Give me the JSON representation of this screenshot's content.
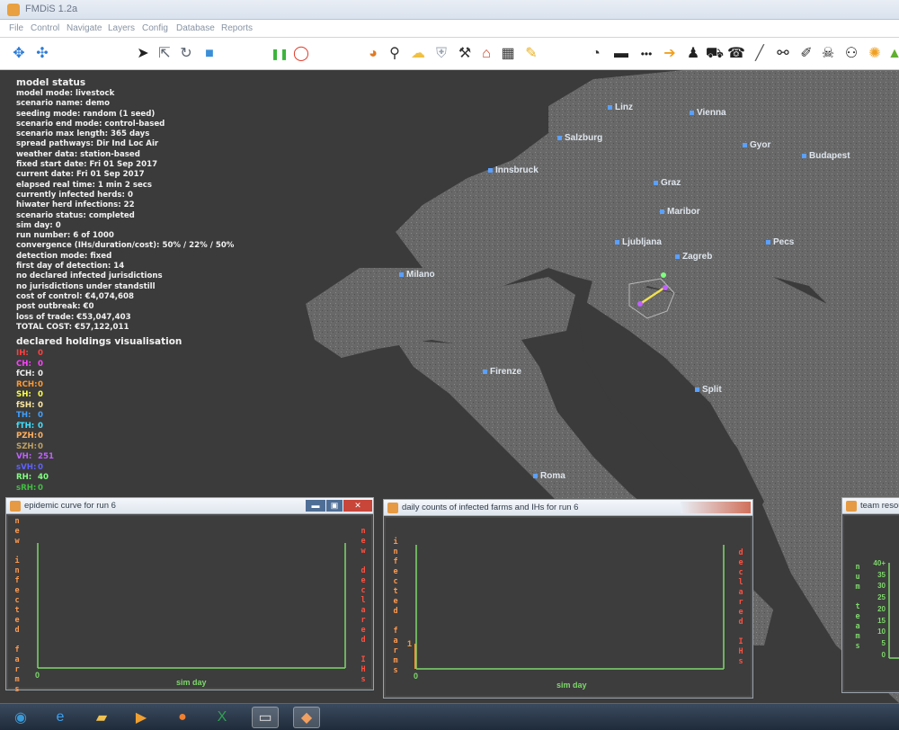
{
  "window": {
    "title": "FMDiS 1.2a"
  },
  "menu": [
    "File",
    "Control",
    "Navigate",
    "Layers",
    "Config",
    "Database",
    "Reports"
  ],
  "toolbar_icons": [
    {
      "name": "zoom-extent-icon",
      "glyph": "✥",
      "color": "#2b7bd6"
    },
    {
      "name": "pan-icon",
      "glyph": "✣",
      "color": "#2b7bd6"
    },
    {
      "name": "select-arrow-icon",
      "glyph": "➤",
      "color": "#222222"
    },
    {
      "name": "pointer-icon",
      "glyph": "⇱",
      "color": "#5b6470"
    },
    {
      "name": "refresh-icon",
      "glyph": "↻",
      "color": "#5b6470"
    },
    {
      "name": "cube-icon",
      "glyph": "■",
      "color": "#3a8fd8"
    },
    {
      "name": "pause-icon",
      "glyph": "❚❚",
      "color": "#3cb43c"
    },
    {
      "name": "stop-icon",
      "glyph": "◯",
      "color": "#e03c2c"
    },
    {
      "name": "pie-chart-icon",
      "glyph": "◕",
      "color": "#e07a24"
    },
    {
      "name": "magnifier-icon",
      "glyph": "⚲",
      "color": "#333333"
    },
    {
      "name": "cloud-icon",
      "glyph": "☁",
      "color": "#f0c040"
    },
    {
      "name": "shield-icon",
      "glyph": "⛨",
      "color": "#9aa4b0"
    },
    {
      "name": "hammer-icon",
      "glyph": "⚒",
      "color": "#333333"
    },
    {
      "name": "farm-icon",
      "glyph": "⌂",
      "color": "#c83c1c"
    },
    {
      "name": "grid-icon",
      "glyph": "▦",
      "color": "#333333"
    },
    {
      "name": "pencil-icon",
      "glyph": "✎",
      "color": "#e8b020"
    },
    {
      "name": "wifi-icon",
      "glyph": "◔",
      "color": "#333333"
    },
    {
      "name": "rectangle-icon",
      "glyph": "▬",
      "color": "#222222"
    },
    {
      "name": "dots-icon",
      "glyph": "•••",
      "color": "#222222"
    },
    {
      "name": "arrow-right-icon",
      "glyph": "➔",
      "color": "#f0a020"
    },
    {
      "name": "person-icon",
      "glyph": "♟",
      "color": "#222222"
    },
    {
      "name": "truck-icon",
      "glyph": "⛟",
      "color": "#222222"
    },
    {
      "name": "telephone-icon",
      "glyph": "☎",
      "color": "#222222"
    },
    {
      "name": "line-icon",
      "glyph": "╱",
      "color": "#555555"
    },
    {
      "name": "binoculars-icon",
      "glyph": "⚯",
      "color": "#222222"
    },
    {
      "name": "syringe-icon",
      "glyph": "✐",
      "color": "#333333"
    },
    {
      "name": "skull-icon",
      "glyph": "☠",
      "color": "#222222"
    },
    {
      "name": "people-icon",
      "glyph": "⚇",
      "color": "#222222"
    },
    {
      "name": "cattle-icon",
      "glyph": "✺",
      "color": "#f0a020"
    },
    {
      "name": "leaf-icon",
      "glyph": "▲",
      "color": "#60b030"
    }
  ],
  "model_status": {
    "heading": "model status",
    "lines": [
      "model mode: livestock",
      "scenario name: demo",
      "seeding mode: random (1 seed)",
      "scenario end mode: control-based",
      "scenario max length: 365 days",
      "spread pathways: Dir Ind Loc Air",
      "weather data: station-based",
      "fixed start date: Fri 01 Sep 2017",
      "current date: Fri 01 Sep 2017",
      "elapsed real time: 1 min 2 secs",
      "currently infected herds: 0",
      "hiwater herd infections: 22",
      "scenario status: completed",
      "sim day: 0",
      "run number: 6 of 1000",
      "convergence (IHs/duration/cost): 50% / 22% / 50%",
      "detection mode: fixed",
      "first day of detection: 14",
      "no declared infected jurisdictions",
      "no jurisdictions under standstill",
      "cost of control: €4,074,608",
      "post outbreak: €0",
      "loss of trade:  €53,047,403",
      "TOTAL COST:  €57,122,011"
    ]
  },
  "declared_holdings": {
    "heading": "declared holdings visualisation",
    "items": [
      {
        "code": "IH:",
        "value": "0",
        "color": "#ff4040"
      },
      {
        "code": "CH:",
        "value": "0",
        "color": "#ff40ff"
      },
      {
        "code": "fCH:",
        "value": "0",
        "color": "#f0f0f0"
      },
      {
        "code": "RCH:",
        "value": "0",
        "color": "#ff9a30"
      },
      {
        "code": "SH:",
        "value": "0",
        "color": "#ffff40"
      },
      {
        "code": "fSH:",
        "value": "0",
        "color": "#ffe8a0"
      },
      {
        "code": "TH:",
        "value": "0",
        "color": "#40a0ff"
      },
      {
        "code": "fTH:",
        "value": "0",
        "color": "#40e0ff"
      },
      {
        "code": "PZH:",
        "value": "0",
        "color": "#ffb060"
      },
      {
        "code": "SZH:",
        "value": "0",
        "color": "#c0a060"
      },
      {
        "code": "VH:",
        "value": "251",
        "color": "#c060ff"
      },
      {
        "code": "sVH:",
        "value": "0",
        "color": "#6060ff"
      },
      {
        "code": "RH:",
        "value": "40",
        "color": "#80ff80"
      },
      {
        "code": "sRH:",
        "value": "0",
        "color": "#40c040"
      }
    ]
  },
  "cities": [
    {
      "name": "Linz"
    },
    {
      "name": "Vienna"
    },
    {
      "name": "Salzburg"
    },
    {
      "name": "Gyor"
    },
    {
      "name": "Budapest"
    },
    {
      "name": "Innsbruck"
    },
    {
      "name": "Graz"
    },
    {
      "name": "Maribor"
    },
    {
      "name": "Ljubljana"
    },
    {
      "name": "Zagreb"
    },
    {
      "name": "Pecs"
    },
    {
      "name": "Milano"
    },
    {
      "name": "Firenze"
    },
    {
      "name": "Split"
    },
    {
      "name": "Roma"
    }
  ],
  "panels": {
    "epidemic": {
      "title": "epidemic curve for run 6",
      "left_label": "new infected farms",
      "right_label": "new declared IHs",
      "x_label": "sim day",
      "x_origin": "0"
    },
    "daily": {
      "title": "daily counts of infected farms and IHs for run 6",
      "left_label": "infected farms",
      "right_label": "declared IHs",
      "x_label": "sim day",
      "x_origin": "0",
      "y_tick": "1"
    },
    "team": {
      "title": "team resou",
      "y_label": "num teams",
      "y_ticks": [
        "40+",
        "35",
        "30",
        "25",
        "20",
        "15",
        "10",
        "5",
        "0"
      ]
    }
  },
  "taskbar": [
    {
      "name": "start-button-icon",
      "glyph": "◉",
      "color": "#3a9ad8"
    },
    {
      "name": "ie-browser-icon",
      "glyph": "e",
      "color": "#3aa0f0"
    },
    {
      "name": "file-explorer-icon",
      "glyph": "▰",
      "color": "#f0c050"
    },
    {
      "name": "media-player-icon",
      "glyph": "▶",
      "color": "#f0a030"
    },
    {
      "name": "firefox-icon",
      "glyph": "●",
      "color": "#f08030"
    },
    {
      "name": "excel-icon",
      "glyph": "X",
      "color": "#30a050"
    },
    {
      "name": "terminal-icon",
      "glyph": "▭",
      "color": "#e0e0e0"
    },
    {
      "name": "fmdis-app-icon",
      "glyph": "◆",
      "color": "#f0a060"
    }
  ]
}
